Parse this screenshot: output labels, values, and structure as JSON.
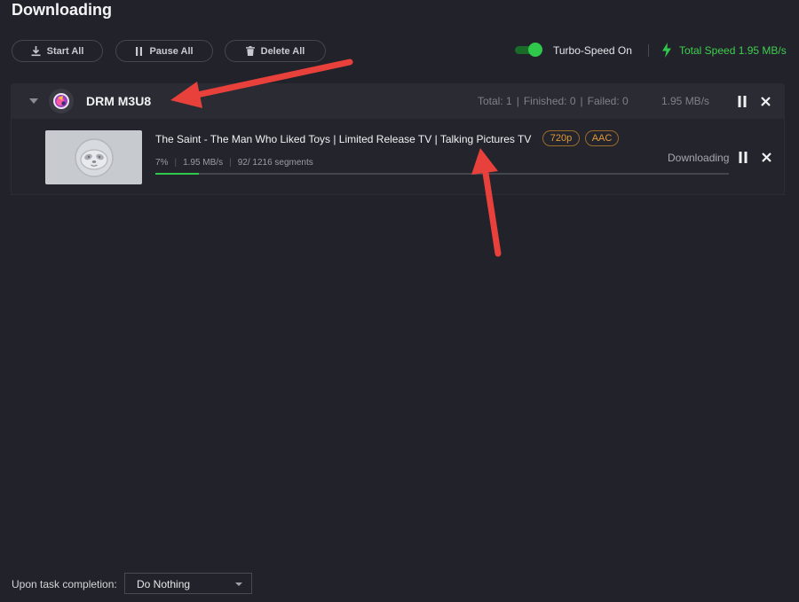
{
  "header": {
    "title": "Downloading"
  },
  "toolbar": {
    "start_all": "Start All",
    "pause_all": "Pause All",
    "delete_all": "Delete All",
    "turbo_label": "Turbo-Speed On",
    "turbo_enabled": true,
    "total_speed": "Total Speed 1.95 MB/s"
  },
  "group": {
    "name": "DRM M3U8",
    "total": "Total: 1",
    "finished": "Finished: 0",
    "failed": "Failed: 0",
    "speed": "1.95 MB/s"
  },
  "item": {
    "title": "The Saint - The Man Who Liked Toys | Limited Release TV | Talking Pictures TV",
    "resolution": "720p",
    "audio": "AAC",
    "percent": "7%",
    "speed": "1.95 MB/s",
    "segments": "92/ 1216 segments",
    "status": "Downloading",
    "progress": 0.076
  },
  "footer": {
    "label": "Upon task completion:",
    "selected": "Do Nothing"
  },
  "colors": {
    "background": "#22222a",
    "accent_green": "#2fc84a",
    "tag_orange": "#e09a3a",
    "annotation_arrow": "#e8403a"
  }
}
